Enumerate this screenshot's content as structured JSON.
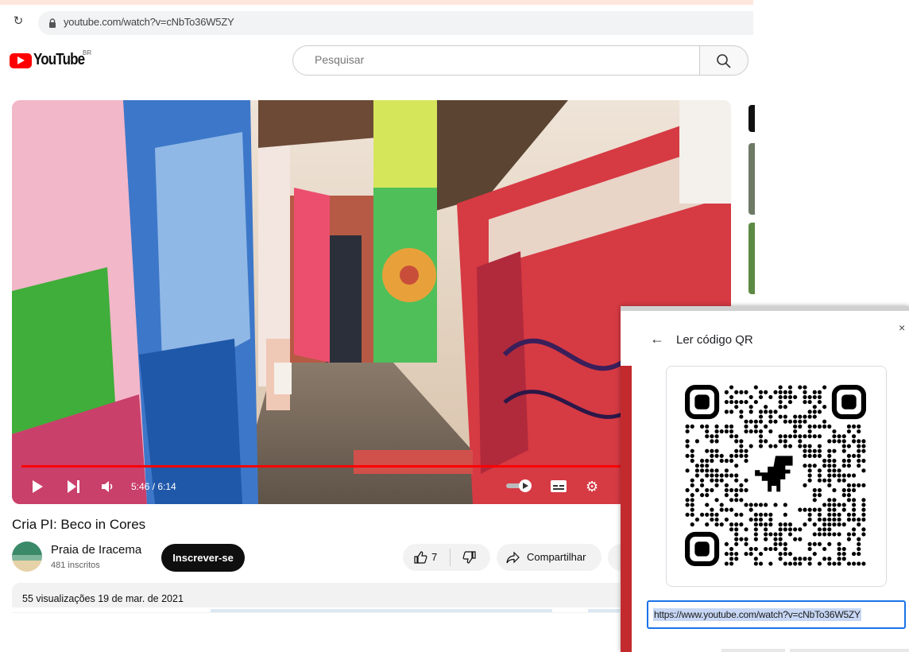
{
  "browser": {
    "url": "youtube.com/watch?v=cNbTo36W5ZY",
    "reload_icon": "reload-icon",
    "lock_icon": "lock-icon"
  },
  "header": {
    "logo_text": "YouTube",
    "region": "BR",
    "search_placeholder": "Pesquisar"
  },
  "player": {
    "time": "5:46 / 6:14",
    "progress": 0.935
  },
  "video": {
    "title": "Cria PI: Beco in Cores",
    "channel": "Praia de Iracema",
    "subscribers": "481 inscritos",
    "subscribe_label": "Inscrever-se",
    "likes": "7",
    "share_label": "Compartilhar",
    "meta": "55 visualizações  19 de mar. de 2021"
  },
  "qr_dialog": {
    "title": "Ler código QR",
    "link": "https://www.youtube.com/watch?v=cNbTo36W5ZY",
    "close_symbol": "×",
    "back_symbol": "←"
  },
  "colors": {
    "brand_red": "#ff0000",
    "focus_blue": "#1a73e8"
  }
}
